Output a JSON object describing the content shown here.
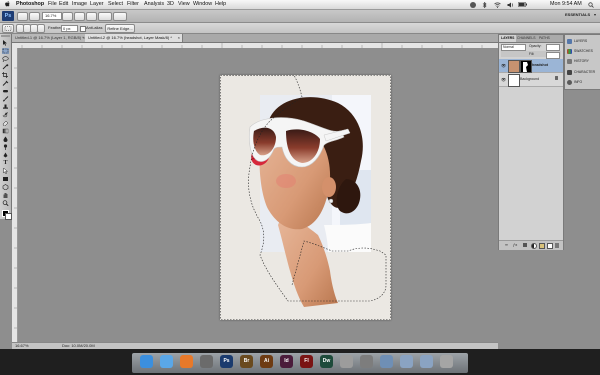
{
  "menubar": {
    "apple_icon": "apple-icon",
    "items": [
      "Photoshop",
      "File",
      "Edit",
      "Image",
      "Layer",
      "Select",
      "Filter",
      "Analysis",
      "3D",
      "View",
      "Window",
      "Help"
    ],
    "clock": "Mon 9:54 AM"
  },
  "appbar": {
    "zoom": "16.7%",
    "workspace_label": "ESSENTIALS"
  },
  "options": {
    "feather_label": "Feather:",
    "feather_value": "0 px",
    "antialias_label": "Anti-alias",
    "refine_edge": "Refine Edge..."
  },
  "doc_tabs": [
    {
      "label": "Untitled-1 @ 16.7% (Layer 1, RGB/8) *",
      "active": false
    },
    {
      "label": "Untitled-2 @ 16.7% (headshot, Layer Mask/8) *",
      "active": true
    }
  ],
  "status": {
    "zoom": "16.67%",
    "doc_size": "Doc: 10.0M/20.0M"
  },
  "layers_panel": {
    "tabs": [
      "LAYERS",
      "CHANNELS",
      "PATHS"
    ],
    "blend_mode": "Normal",
    "opacity_label": "Opacity:",
    "fill_label": "Fill:",
    "layers": [
      {
        "name": "headshot",
        "selected": true
      },
      {
        "name": "Background",
        "selected": false
      }
    ]
  },
  "collapsed_panels": [
    {
      "label": "LAYERS",
      "icon": "layers-icon"
    },
    {
      "label": "SWATCHES",
      "icon": "swatches-icon"
    },
    {
      "label": "HISTORY",
      "icon": "history-icon"
    },
    {
      "label": "CHARACTER",
      "icon": "character-icon"
    },
    {
      "label": "INFO",
      "icon": "info-icon"
    }
  ],
  "dock_apps": [
    {
      "name": "finder-icon",
      "color": "#3b8fde",
      "glyph": ""
    },
    {
      "name": "safari-icon",
      "color": "#5aa7e8",
      "glyph": ""
    },
    {
      "name": "firefox-icon",
      "color": "#e8792a",
      "glyph": ""
    },
    {
      "name": "app-store-icon",
      "color": "#6b6b6b",
      "glyph": ""
    },
    {
      "name": "photoshop-icon",
      "color": "#1b3b6e",
      "glyph": "Ps"
    },
    {
      "name": "bridge-icon",
      "color": "#6a4a1e",
      "glyph": "Br"
    },
    {
      "name": "illustrator-icon",
      "color": "#6e3b12",
      "glyph": "Ai"
    },
    {
      "name": "indesign-icon",
      "color": "#4b1c3b",
      "glyph": "Id"
    },
    {
      "name": "flash-icon",
      "color": "#7a1414",
      "glyph": "Fl"
    },
    {
      "name": "dreamweaver-icon",
      "color": "#1e4b3b",
      "glyph": "Dw"
    },
    {
      "name": "preview-icon",
      "color": "#9c9c9c",
      "glyph": ""
    },
    {
      "name": "system-preferences-icon",
      "color": "#7d7d7d",
      "glyph": ""
    },
    {
      "name": "folder-icon",
      "color": "#6f8fb5",
      "glyph": ""
    },
    {
      "name": "documents-stack-icon",
      "color": "#8aa3c2",
      "glyph": ""
    },
    {
      "name": "downloads-stack-icon",
      "color": "#8aa3c2",
      "glyph": ""
    },
    {
      "name": "trash-icon",
      "color": "#a5a5a5",
      "glyph": ""
    }
  ]
}
